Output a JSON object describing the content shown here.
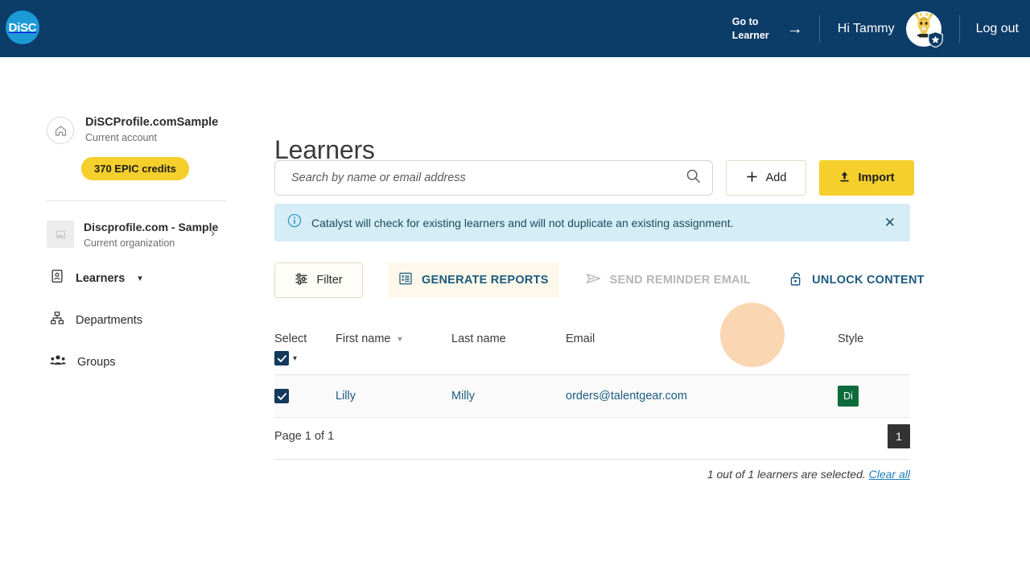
{
  "header": {
    "logo_text": "DiSC",
    "logo_icon": "disc-logo-icon",
    "goto_learner_line1": "Go to",
    "goto_learner_line2": "Learner",
    "arrow_icon": "arrow-right-icon",
    "greeting": "Hi Tammy",
    "avatar_icon": "giraffe-avatar",
    "avatar_badge_icon": "shield-star-icon",
    "logout_label": "Log out",
    "bar_color": "#0c3c68"
  },
  "sidebar": {
    "account": {
      "icon": "home-icon",
      "name": "DiSCProfile.comSample",
      "subtitle": "Current account"
    },
    "credits_label": "370 EPIC credits",
    "credits_color": "#f5cf2c",
    "organization": {
      "thumb_icon": "image-placeholder-icon",
      "name": "Discprofile.com - Sample",
      "subtitle": "Current organization",
      "chevron_icon": "chevron-right-icon"
    },
    "nav": [
      {
        "label": "Learners",
        "icon": "learner-card-icon",
        "chevron": "chevron-down-icon",
        "active": true
      },
      {
        "label": "Departments",
        "icon": "org-chart-icon",
        "active": false
      },
      {
        "label": "Groups",
        "icon": "people-group-icon",
        "active": false
      }
    ]
  },
  "main": {
    "title": "Learners",
    "search": {
      "placeholder": "Search by name or email address",
      "value": "",
      "icon": "search-icon"
    },
    "add_button": {
      "label": "Add",
      "icon": "plus-icon"
    },
    "import_button": {
      "label": "Import",
      "icon": "upload-icon"
    },
    "banner": {
      "icon": "info-circle-icon",
      "text": "Catalyst will check for existing learners and will not duplicate an existing assignment.",
      "close_icon": "close-icon",
      "background": "#d4edf7"
    },
    "actions": {
      "filter": {
        "label": "Filter",
        "icon": "filter-sliders-icon"
      },
      "generate_reports": {
        "label": "GENERATE REPORTS",
        "icon": "report-list-icon",
        "state": "hovered"
      },
      "send_reminder": {
        "label": "SEND REMINDER EMAIL",
        "icon": "send-paper-plane-icon",
        "state": "disabled"
      },
      "unlock_content": {
        "label": "UNLOCK CONTENT",
        "icon": "unlock-padlock-icon",
        "state": "enabled"
      }
    },
    "table": {
      "columns": [
        "Select",
        "First name",
        "Last name",
        "Email",
        "Style"
      ],
      "select_all_checked": true,
      "sort_column": "First name",
      "rows": [
        {
          "selected": true,
          "first_name": "Lilly",
          "last_name": "Milly",
          "email": "orders@talentgear.com",
          "style": "Di",
          "style_color": "#0b6b3a"
        }
      ]
    },
    "pagination": {
      "page_label": "Page 1 of 1",
      "current_page": "1"
    },
    "selection_note": "1 out of 1 learners are selected.",
    "clear_all_label": "Clear all"
  }
}
